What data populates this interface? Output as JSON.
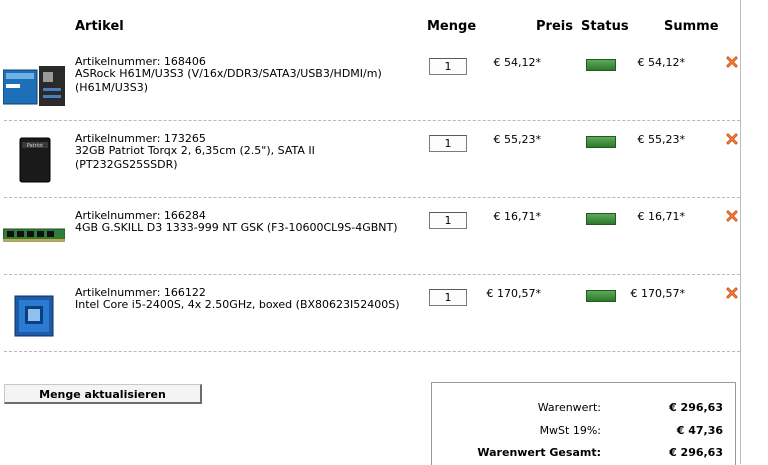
{
  "header": {
    "artikel": "Artikel",
    "menge": "Menge",
    "preis": "Preis",
    "status": "Status",
    "summe": "Summe"
  },
  "items": [
    {
      "artnr": "Artikelnummer: 168406",
      "name": "ASRock H61M/U3S3 (V/16x/DDR3/SATA3/USB3/HDMI/m) (H61M/U3S3)",
      "qty": "1",
      "price": "€ 54,12*",
      "sum": "€ 54,12*",
      "status_color": "#3f8f3d"
    },
    {
      "artnr": "Artikelnummer: 173265",
      "name": "32GB Patriot Torqx 2, 6,35cm (2.5\"), SATA II (PT232GS25SSDR)",
      "qty": "1",
      "price": "€ 55,23*",
      "sum": "€ 55,23*",
      "status_color": "#3f8f3d"
    },
    {
      "artnr": "Artikelnummer: 166284",
      "name": "4GB G.SKILL D3 1333-999 NT GSK (F3-10600CL9S-4GBNT)",
      "qty": "1",
      "price": "€ 16,71*",
      "sum": "€ 16,71*",
      "status_color": "#3f8f3d"
    },
    {
      "artnr": "Artikelnummer: 166122",
      "name": "Intel Core i5-2400S, 4x 2.50GHz, boxed (BX80623I52400S)",
      "qty": "1",
      "price": "€ 170,57*",
      "sum": "€ 170,57*",
      "status_color": "#3f8f3d"
    }
  ],
  "update_button": "Menge aktualisieren",
  "totals": {
    "warenwert_label": "Warenwert:",
    "warenwert_value": "€ 296,63",
    "mwst_label": "MwSt 19%:",
    "mwst_value": "€ 47,36",
    "gesamt_label": "Warenwert Gesamt:",
    "gesamt_value": "€ 296,63"
  },
  "icons": {
    "delete": "close-x-icon",
    "status": "status-bar-icon"
  }
}
